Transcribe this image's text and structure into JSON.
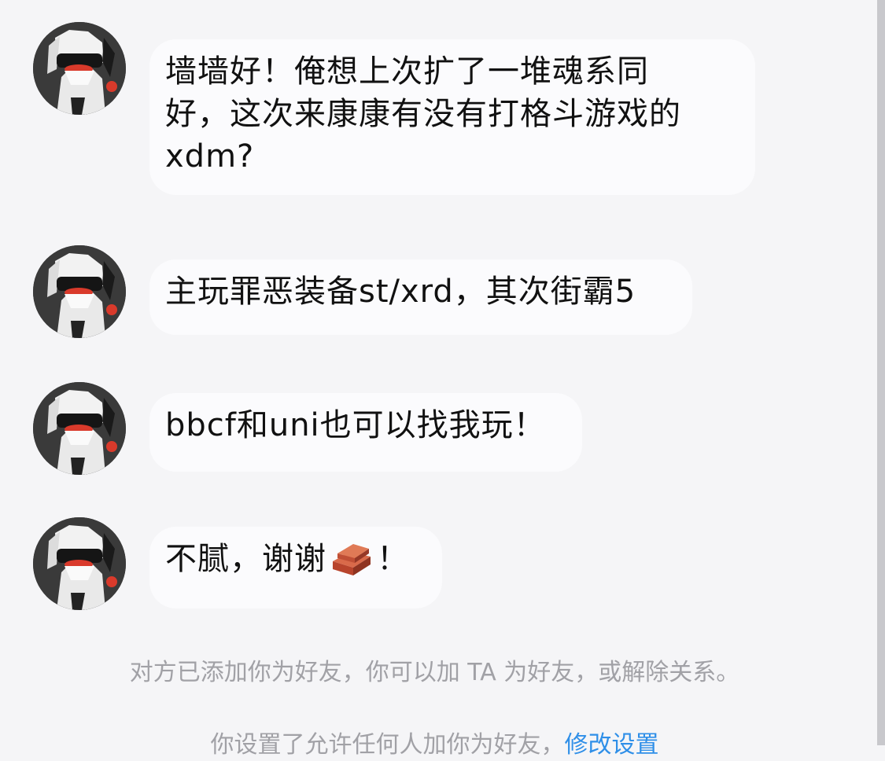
{
  "conversation": {
    "messages": [
      {
        "sender_avatar": "avatar-manga-character",
        "text": "墙墙好！俺想上次扩了一堆魂系同\n好，这次来康康有没有打格斗游戏的\nxdm?"
      },
      {
        "sender_avatar": "avatar-manga-character",
        "text": "主玩罪恶装备st/xrd，其次街霸5"
      },
      {
        "sender_avatar": "avatar-manga-character",
        "text": "bbcf和uni也可以找我玩！"
      },
      {
        "sender_avatar": "avatar-manga-character",
        "text_before": "不腻，谢谢",
        "emoji": "brick-emoji",
        "text_after": "！"
      }
    ],
    "system_notice": "对方已添加你为好友，你可以加 TA 为好友，或解除关系。",
    "settings_notice": {
      "text": "你设置了允许任何人加你为好友，",
      "link": "修改设置"
    }
  },
  "colors": {
    "background": "#f5f5f7",
    "bubble": "#fbfbfd",
    "system_text": "#a1a1a6",
    "link": "#2f8fe8"
  }
}
